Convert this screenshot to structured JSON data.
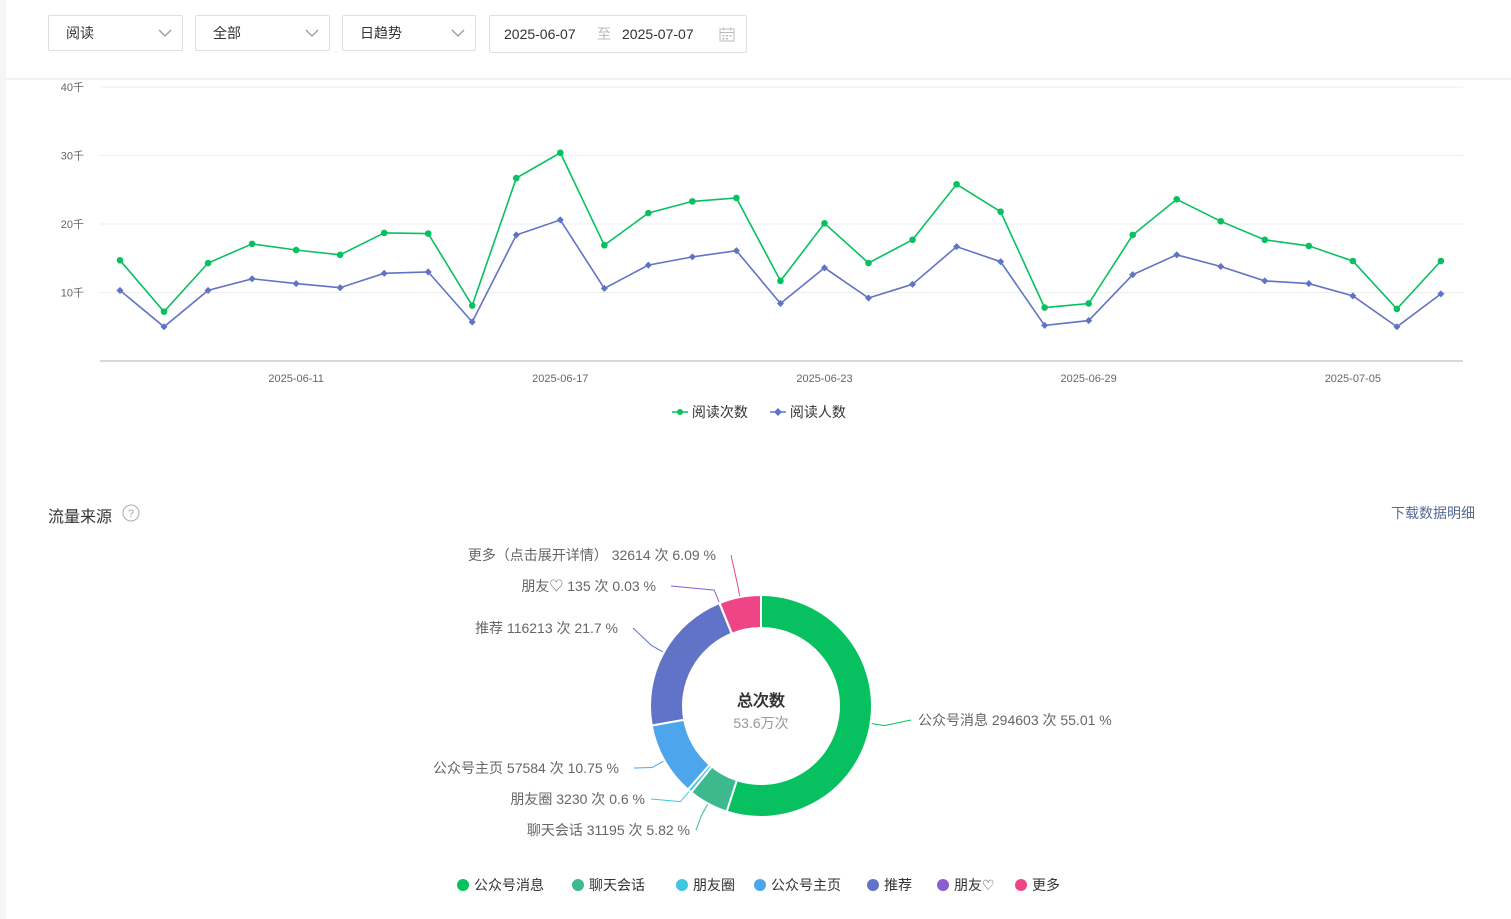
{
  "filters": {
    "metric": "阅读",
    "scope": "全部",
    "granularity": "日趋势",
    "date_start": "2025-06-07",
    "date_sep": "至",
    "date_end": "2025-07-07"
  },
  "colors": {
    "reads": "#07c160",
    "readers": "#6173c7"
  },
  "chart_data": [
    {
      "type": "line",
      "x": [
        "2025-06-07",
        "2025-06-08",
        "2025-06-09",
        "2025-06-10",
        "2025-06-11",
        "2025-06-12",
        "2025-06-13",
        "2025-06-14",
        "2025-06-15",
        "2025-06-16",
        "2025-06-17",
        "2025-06-18",
        "2025-06-19",
        "2025-06-20",
        "2025-06-21",
        "2025-06-22",
        "2025-06-23",
        "2025-06-24",
        "2025-06-25",
        "2025-06-26",
        "2025-06-27",
        "2025-06-28",
        "2025-06-29",
        "2025-06-30",
        "2025-07-01",
        "2025-07-02",
        "2025-07-03",
        "2025-07-04",
        "2025-07-05",
        "2025-07-06",
        "2025-07-07"
      ],
      "x_tick_labels": [
        "2025-06-11",
        "2025-06-17",
        "2025-06-23",
        "2025-06-29",
        "2025-07-05"
      ],
      "y_tick_labels": [
        "10千",
        "20千",
        "30千",
        "40千"
      ],
      "y_ticks": [
        10000,
        20000,
        30000,
        40000
      ],
      "ylim": [
        0,
        40000
      ],
      "grid": true,
      "legend_position": "bottom",
      "series": [
        {
          "name": "阅读次数",
          "values": [
            14700,
            7200,
            14300,
            17100,
            16200,
            15500,
            18700,
            18600,
            8100,
            26700,
            30400,
            16900,
            21600,
            23300,
            23800,
            11700,
            20100,
            14300,
            17700,
            25800,
            21800,
            7800,
            8400,
            18400,
            23600,
            20400,
            17700,
            16800,
            14600,
            7600,
            14600
          ]
        },
        {
          "name": "阅读人数",
          "values": [
            10300,
            5000,
            10300,
            12000,
            11300,
            10700,
            12800,
            13000,
            5700,
            18400,
            20600,
            10600,
            14000,
            15200,
            16100,
            8400,
            13600,
            9200,
            11200,
            16700,
            14500,
            5200,
            5900,
            12600,
            15500,
            13800,
            11700,
            11300,
            9500,
            5000,
            9800
          ]
        }
      ]
    },
    {
      "type": "pie",
      "center_title": "总次数",
      "center_value": "53.6万次",
      "categories": [
        "公众号消息",
        "聊天会话",
        "朋友圈",
        "公众号主页",
        "推荐",
        "朋友♡",
        "更多"
      ],
      "values": [
        294603,
        31195,
        3230,
        57584,
        116213,
        135,
        32614
      ],
      "labels": [
        "公众号消息 294603 次 55.01 %",
        "聊天会话 31195 次 5.82 %",
        "朋友圈 3230 次 0.6 %",
        "公众号主页 57584 次 10.75 %",
        "推荐 116213 次 21.7 %",
        "朋友♡ 135 次 0.03 %",
        "更多（点击展开详情） 32614 次 6.09 %"
      ],
      "colors": [
        "#07c160",
        "#3cb98d",
        "#3fc6e0",
        "#4da5ec",
        "#6173c7",
        "#8a5fd1",
        "#ef4587"
      ],
      "legend_position": "bottom"
    }
  ],
  "traffic": {
    "title": "流量来源",
    "download_label": "下载数据明细"
  }
}
